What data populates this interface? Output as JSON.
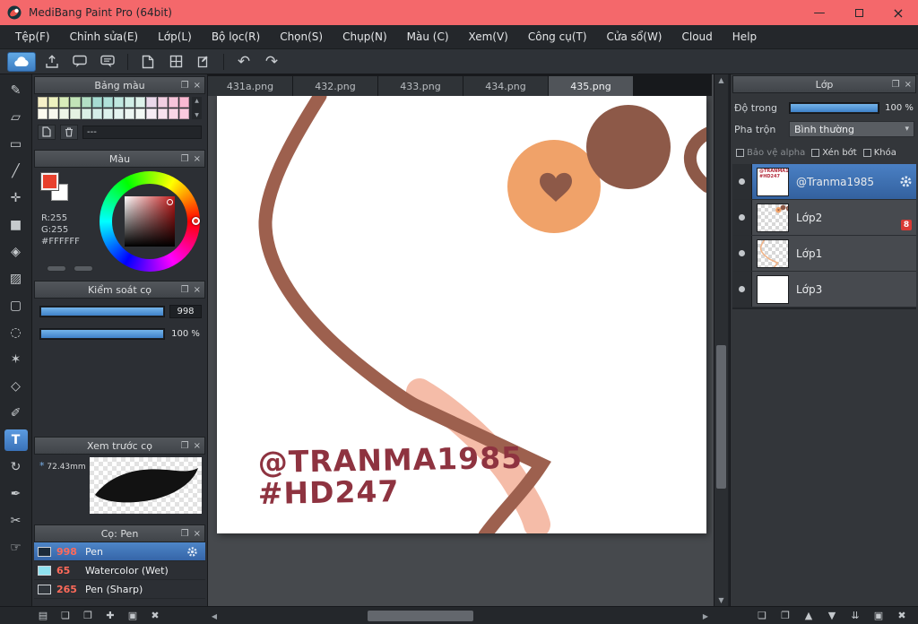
{
  "window": {
    "title": "MediBang Paint Pro (64bit)",
    "minimize_glyph": "—",
    "close_glyph": "×"
  },
  "menubar": {
    "items": [
      "Tệp(F)",
      "Chỉnh sửa(E)",
      "Lớp(L)",
      "Bộ lọc(R)",
      "Chọn(S)",
      "Chụp(N)",
      "Màu (C)",
      "Xem(V)",
      "Công cụ(T)",
      "Cửa sổ(W)",
      "Cloud",
      "Help"
    ]
  },
  "toolbar": {
    "undo_glyph": "↶",
    "redo_glyph": "↷"
  },
  "toolstrip": {
    "tools": [
      {
        "name": "brush",
        "glyph": "✎"
      },
      {
        "name": "eraser",
        "glyph": "▱"
      },
      {
        "name": "select-rectangle",
        "glyph": "▭"
      },
      {
        "name": "line",
        "glyph": "╱"
      },
      {
        "name": "move",
        "glyph": "✛"
      },
      {
        "name": "shape-fill",
        "glyph": "■"
      },
      {
        "name": "bucket-fill",
        "glyph": "◈"
      },
      {
        "name": "gradient",
        "glyph": "▨"
      },
      {
        "name": "select-marquee",
        "glyph": "▢"
      },
      {
        "name": "lasso",
        "glyph": "◌"
      },
      {
        "name": "magic-wand",
        "glyph": "✶"
      },
      {
        "name": "select-pattern",
        "glyph": "◇"
      },
      {
        "name": "select-pen",
        "glyph": "✐"
      },
      {
        "name": "text",
        "glyph": "T",
        "selected": true
      },
      {
        "name": "operation",
        "glyph": "↻"
      },
      {
        "name": "pen",
        "glyph": "✒"
      },
      {
        "name": "divide",
        "glyph": "✂"
      },
      {
        "name": "hand",
        "glyph": "☞"
      }
    ]
  },
  "palette": {
    "title": "Bảng màu",
    "name_placeholder": "---",
    "swatches": [
      "#f6f0c8",
      "#eef2c0",
      "#d8ecba",
      "#c2e4b8",
      "#b2dfc4",
      "#a6dcd2",
      "#b0e2da",
      "#c0e8e0",
      "#d0eee6",
      "#ddf2ea",
      "#ead8ea",
      "#f2cfe2",
      "#f6c4da",
      "#fab8d2",
      "#fdfbef",
      "#f8f8ee",
      "#eef6e8",
      "#e4f2e2",
      "#daf0e6",
      "#d4eee8",
      "#dcf2ec",
      "#e4f4f0",
      "#ecf6f2",
      "#f2f8f4",
      "#f6ecf4",
      "#f8e2ee",
      "#fad6e6",
      "#fccade"
    ]
  },
  "color_panel": {
    "title": "Màu",
    "r_label": "R:255",
    "g_label": "G:255",
    "hex_label": "#FFFFFF",
    "foreground": "#e8402c",
    "background": "#ffffff"
  },
  "brush_control": {
    "title": "Kiểm soát cọ",
    "size_value": "998",
    "opacity_value": "100 %"
  },
  "brush_preview": {
    "title": "Xem trước cọ",
    "asterisk": "*",
    "size_note": "72.43mm"
  },
  "brush_list": {
    "title": "Cọ: Pen",
    "brushes": [
      {
        "size": "998",
        "name": "Pen",
        "chip": "#1c2b3a",
        "selected": true
      },
      {
        "size": "65",
        "name": "Watercolor (Wet)",
        "chip": "#8fe1ef"
      },
      {
        "size": "265",
        "name": "Pen (Sharp)",
        "chip": "#30353b"
      }
    ]
  },
  "canvas": {
    "tabs": [
      {
        "label": "431a.png"
      },
      {
        "label": "432.png"
      },
      {
        "label": "433.png"
      },
      {
        "label": "434.png"
      },
      {
        "label": "435.png",
        "active": true
      }
    ],
    "watermark": {
      "line1": "@TRANMA1985",
      "line2": "#HD247",
      "color": "#8e3340"
    },
    "art": {
      "line": "#9d604e",
      "circle_orange": "#f0a269",
      "circle_brown": "#8d5948",
      "pink": "#f5bca8"
    }
  },
  "layers_panel": {
    "title": "Lớp",
    "opacity_label": "Độ trong",
    "opacity_value": "100 %",
    "blend_label": "Pha trộn",
    "blend_value": "Bình thường",
    "blend_arrow": "▾",
    "alpha_lock_label": "Bảo vệ alpha",
    "clip_label": "Xén bớt",
    "lock_label": "Khóa",
    "layers": [
      {
        "name": "@Tranma1985",
        "selected": true
      },
      {
        "name": "Lớp2",
        "badge": "8"
      },
      {
        "name": "Lớp1"
      },
      {
        "name": "Lớp3"
      }
    ]
  },
  "bottom_left_icons": [
    {
      "name": "brush-panel-menu",
      "glyph": "▤"
    },
    {
      "name": "add-brush",
      "glyph": "❏"
    },
    {
      "name": "duplicate-brush",
      "glyph": "❐"
    },
    {
      "name": "add-brush-folder",
      "glyph": "✚"
    },
    {
      "name": "brush-settings",
      "glyph": "▣"
    },
    {
      "name": "delete-brush",
      "glyph": "✖"
    }
  ],
  "bottom_right_icons": [
    {
      "name": "add-layer",
      "glyph": "❏"
    },
    {
      "name": "duplicate-layer",
      "glyph": "❐"
    },
    {
      "name": "move-layer-up",
      "glyph": "▲"
    },
    {
      "name": "move-layer-down",
      "glyph": "▼"
    },
    {
      "name": "merge-layer-down",
      "glyph": "⇊"
    },
    {
      "name": "flatten-layers",
      "glyph": "▣"
    },
    {
      "name": "delete-layer",
      "glyph": "✖"
    }
  ],
  "panel_chrome": {
    "popout_glyph": "❐",
    "close_glyph": "×",
    "scroll_up": "▲",
    "scroll_down": "▼",
    "scroll_left": "◀",
    "scroll_right": "▶"
  },
  "colors": {
    "titlebar": "#f4686b",
    "accent_blue": "#4f9bd8",
    "selection_blue": "#3a6fb5"
  }
}
